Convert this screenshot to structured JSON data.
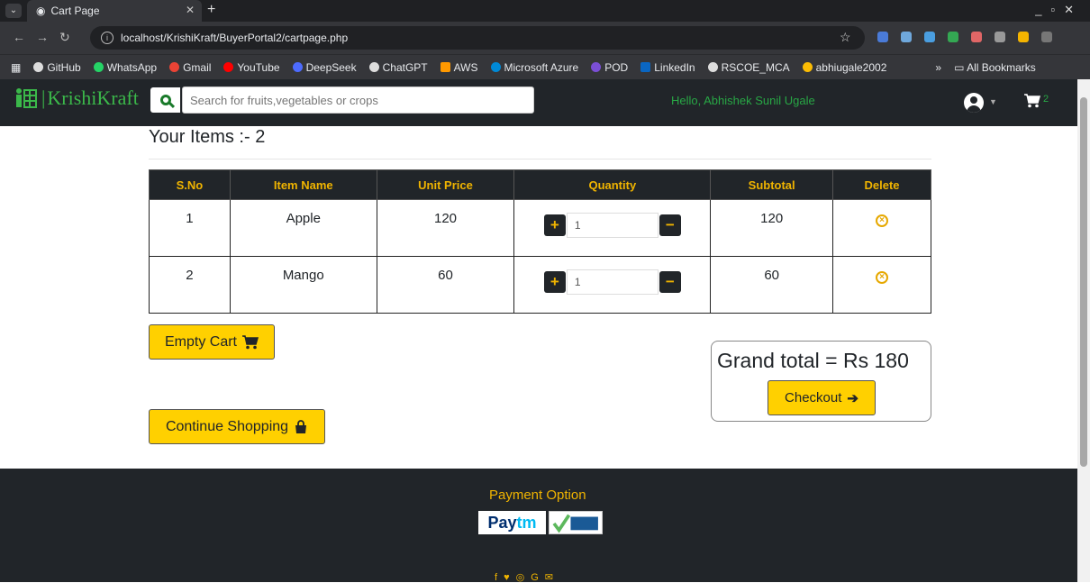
{
  "browser": {
    "tab_title": "Cart Page",
    "url": "localhost/KrishiKraft/BuyerPortal2/cartpage.php",
    "bookmarks": [
      "GitHub",
      "WhatsApp",
      "Gmail",
      "YouTube",
      "DeepSeek",
      "ChatGPT",
      "AWS",
      "Microsoft Azure",
      "POD",
      "LinkedIn",
      "RSCOE_MCA",
      "abhiugale2002"
    ],
    "all_bookmarks": "All Bookmarks"
  },
  "header": {
    "brand": "KrishiKraft",
    "search_placeholder": "Search for fruits,vegetables or crops",
    "greeting": "Hello, Abhishek Sunil Ugale",
    "cart_count": "2"
  },
  "cart": {
    "items_title": "Your Items :- 2",
    "columns": [
      "S.No",
      "Item Name",
      "Unit Price",
      "Quantity",
      "Subtotal",
      "Delete"
    ],
    "rows": [
      {
        "sno": "1",
        "name": "Apple",
        "price": "120",
        "qty": "1",
        "subtotal": "120"
      },
      {
        "sno": "2",
        "name": "Mango",
        "price": "60",
        "qty": "1",
        "subtotal": "60"
      }
    ],
    "empty_cart": "Empty Cart",
    "continue_shopping": "Continue Shopping",
    "grand_total": "Grand total = Rs 180",
    "checkout": "Checkout"
  },
  "footer": {
    "payment_option": "Payment Option"
  },
  "colors": {
    "accent": "#ffd000",
    "dark": "#212529",
    "green": "#28a745"
  }
}
